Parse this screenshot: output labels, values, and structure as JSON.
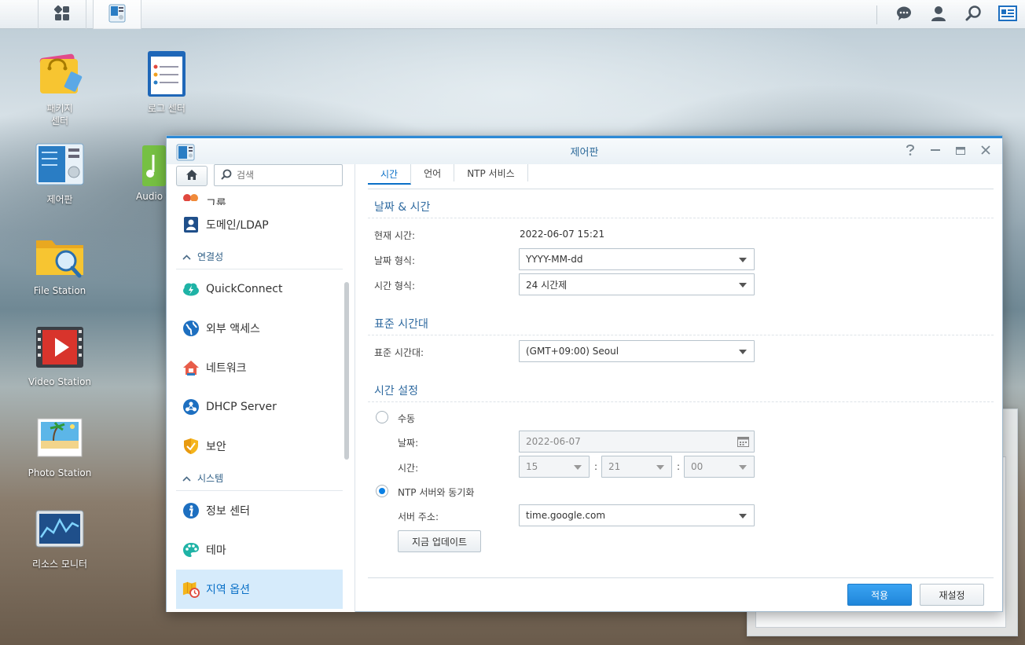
{
  "taskbar": {
    "main_menu_icon": "grid-icon",
    "open_app_icon": "control-panel-icon",
    "right_icons": [
      "chat-icon",
      "user-icon",
      "search-icon",
      "widgets-icon"
    ]
  },
  "desktop": {
    "icons": [
      {
        "name": "package-center",
        "label": "패키지\n센터"
      },
      {
        "name": "log-center",
        "label": "로그 센터"
      },
      {
        "name": "control-panel",
        "label": "제어판"
      },
      {
        "name": "audio-station",
        "label": "Audio S"
      },
      {
        "name": "file-station",
        "label": "File Station"
      },
      {
        "name": "video-station",
        "label": "Video Station"
      },
      {
        "name": "photo-station",
        "label": "Photo Station"
      },
      {
        "name": "resource-monitor",
        "label": "리소스 모니터"
      }
    ]
  },
  "window": {
    "title": "제어판",
    "controls": [
      "help-icon",
      "minimize-icon",
      "maximize-icon",
      "close-icon"
    ]
  },
  "sidebar": {
    "search_placeholder": "검색",
    "partial_item": "그룹",
    "items_top": [
      {
        "label": "도메인/LDAP",
        "icon": "domain-ldap-icon"
      }
    ],
    "section_connectivity": "연결성",
    "items_connectivity": [
      {
        "label": "QuickConnect",
        "icon": "quickconnect-icon"
      },
      {
        "label": "외부 액세스",
        "icon": "external-access-icon"
      },
      {
        "label": "네트워크",
        "icon": "network-icon"
      },
      {
        "label": "DHCP Server",
        "icon": "dhcp-server-icon"
      },
      {
        "label": "보안",
        "icon": "security-icon"
      }
    ],
    "section_system": "시스템",
    "items_system": [
      {
        "label": "정보 센터",
        "icon": "info-center-icon"
      },
      {
        "label": "테마",
        "icon": "theme-icon"
      },
      {
        "label": "지역 옵션",
        "icon": "regional-options-icon",
        "active": true
      }
    ]
  },
  "tabs": [
    {
      "label": "시간",
      "active": true
    },
    {
      "label": "언어"
    },
    {
      "label": "NTP 서비스"
    }
  ],
  "date_time": {
    "section_title": "날짜 & 시간",
    "current_time_label": "현재 시간:",
    "current_time_value": "2022-06-07 15:21",
    "date_format_label": "날짜 형식:",
    "date_format_value": "YYYY-MM-dd",
    "time_format_label": "시간 형식:",
    "time_format_value": "24 시간제"
  },
  "timezone": {
    "section_title": "표준 시간대",
    "label": "표준 시간대:",
    "value": "(GMT+09:00) Seoul"
  },
  "time_setting": {
    "section_title": "시간 설정",
    "manual_label": "수동",
    "manual_selected": false,
    "date_label": "날짜:",
    "date_value": "2022-06-07",
    "time_label": "시간:",
    "hour": "15",
    "minute": "21",
    "second": "00",
    "colon": ":",
    "ntp_label": "NTP 서버와 동기화",
    "ntp_selected": true,
    "server_label": "서버 주소:",
    "server_value": "time.google.com",
    "update_now": "지금 업데이트"
  },
  "footer": {
    "apply": "적용",
    "reset": "재설정"
  },
  "colors": {
    "accent": "#0a70c7",
    "active_bg": "#d6ebfb",
    "primary_button": "#1f86da"
  }
}
